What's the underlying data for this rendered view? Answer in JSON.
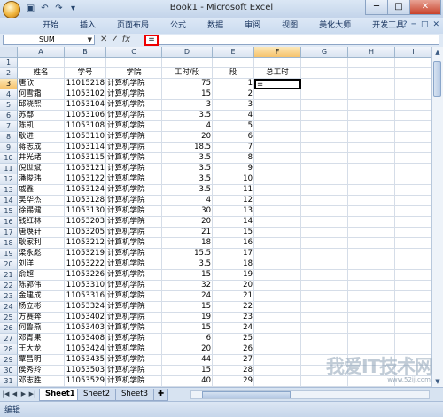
{
  "window": {
    "title": "Book1 - Microsoft Excel"
  },
  "quick_access": [
    "save-icon",
    "undo-icon",
    "redo-icon",
    "dropdown-icon"
  ],
  "window_buttons": {
    "minimize": "─",
    "maximize": "□",
    "close": "✕"
  },
  "ribbon": {
    "tabs": [
      "开始",
      "插入",
      "页面布局",
      "公式",
      "数据",
      "审阅",
      "视图",
      "美化大师",
      "开发工具"
    ],
    "right_icons": [
      "?",
      "─",
      "□",
      "✕"
    ]
  },
  "formula_bar": {
    "name_box": "SUM",
    "cancel": "✕",
    "enter": "✓",
    "fx": "fx",
    "value": "="
  },
  "grid": {
    "columns": [
      "A",
      "B",
      "C",
      "D",
      "E",
      "F",
      "G",
      "H",
      "I"
    ],
    "selected_column": "F",
    "selected_row": "3",
    "active_cell_value": "=",
    "header_row": {
      "row": "2",
      "a": "姓名",
      "b": "学号",
      "c": "学院",
      "d": "工时/段",
      "e": "段",
      "f": "总工时"
    },
    "rows": [
      {
        "row": "1",
        "a": "",
        "b": "",
        "c": "",
        "d": "",
        "e": ""
      },
      {
        "row": "3",
        "a": "唐欣",
        "b": "11015218",
        "c": "计算机学院",
        "d": "75",
        "e": "1"
      },
      {
        "row": "4",
        "a": "何雪霜",
        "b": "11053102",
        "c": "计算机学院",
        "d": "15",
        "e": "2"
      },
      {
        "row": "5",
        "a": "邱晓熙",
        "b": "11053104",
        "c": "计算机学院",
        "d": "3",
        "e": "3"
      },
      {
        "row": "6",
        "a": "苏鄢",
        "b": "11053106",
        "c": "计算机学院",
        "d": "3.5",
        "e": "4"
      },
      {
        "row": "7",
        "a": "陈凯",
        "b": "11053108",
        "c": "计算机学院",
        "d": "4",
        "e": "5"
      },
      {
        "row": "8",
        "a": "耿进",
        "b": "11053110",
        "c": "计算机学院",
        "d": "20",
        "e": "6"
      },
      {
        "row": "9",
        "a": "蒋志成",
        "b": "11053114",
        "c": "计算机学院",
        "d": "18.5",
        "e": "7"
      },
      {
        "row": "10",
        "a": "井光绪",
        "b": "11053115",
        "c": "计算机学院",
        "d": "3.5",
        "e": "8"
      },
      {
        "row": "11",
        "a": "  倪世斌",
        "b": "11053121",
        "c": "计算机学院",
        "d": "3.5",
        "e": "9"
      },
      {
        "row": "12",
        "a": "潘俊玮",
        "b": "11053122",
        "c": "计算机学院",
        "d": "3.5",
        "e": "10"
      },
      {
        "row": "13",
        "a": "戚鑫",
        "b": "11053124",
        "c": "计算机学院",
        "d": "3.5",
        "e": "11"
      },
      {
        "row": "14",
        "a": "吴华杰",
        "b": "11053128",
        "c": "计算机学院",
        "d": "4",
        "e": "12"
      },
      {
        "row": "15",
        "a": "徐锡健",
        "b": "11053130",
        "c": "计算机学院",
        "d": "30",
        "e": "13"
      },
      {
        "row": "16",
        "a": "钱红林",
        "b": "11053203",
        "c": "计算机学院",
        "d": "20",
        "e": "14"
      },
      {
        "row": "17",
        "a": "唐焕轩",
        "b": "11053205",
        "c": "计算机学院",
        "d": "21",
        "e": "15"
      },
      {
        "row": "18",
        "a": "耿家利",
        "b": "11053212",
        "c": "计算机学院",
        "d": "18",
        "e": "16"
      },
      {
        "row": "19",
        "a": "梁永彪",
        "b": "11053219",
        "c": "计算机学院",
        "d": "15.5",
        "e": "17"
      },
      {
        "row": "20",
        "a": "刘洋",
        "b": "11053222",
        "c": "计算机学院",
        "d": "3.5",
        "e": "18"
      },
      {
        "row": "21",
        "a": "俞超",
        "b": "11053226",
        "c": "计算机学院",
        "d": "15",
        "e": "19"
      },
      {
        "row": "22",
        "a": "陈郭伟",
        "b": "11053310",
        "c": "计算机学院",
        "d": "32",
        "e": "20"
      },
      {
        "row": "23",
        "a": "金建成",
        "b": "11053316",
        "c": "计算机学院",
        "d": "24",
        "e": "21"
      },
      {
        "row": "24",
        "a": "杨立彬",
        "b": "11053324",
        "c": "计算机学院",
        "d": "15",
        "e": "22"
      },
      {
        "row": "25",
        "a": "方赛奔",
        "b": "11053402",
        "c": "计算机学院",
        "d": "19",
        "e": "23"
      },
      {
        "row": "26",
        "a": "何鲁燕",
        "b": "11053403",
        "c": "计算机学院",
        "d": "15",
        "e": "24"
      },
      {
        "row": "27",
        "a": "邓青果",
        "b": "11053408",
        "c": "计算机学院",
        "d": "6",
        "e": "25"
      },
      {
        "row": "28",
        "a": "王大龙",
        "b": "11053424",
        "c": "计算机学院",
        "d": "20",
        "e": "26"
      },
      {
        "row": "29",
        "a": "覃昌明",
        "b": "11053435",
        "c": "计算机学院",
        "d": "44",
        "e": "27"
      },
      {
        "row": "30",
        "a": "侯秀羚",
        "b": "11053503",
        "c": "计算机学院",
        "d": "15",
        "e": "28"
      },
      {
        "row": "31",
        "a": "邓志胜",
        "b": "11053529",
        "c": "计算机学院",
        "d": "40",
        "e": "29"
      },
      {
        "row": "32",
        "a": "吴林俊",
        "b": "11053539",
        "c": "计算机学院",
        "d": "30",
        "e": "30"
      }
    ]
  },
  "sheets": [
    "Sheet1",
    "Sheet2",
    "Sheet3"
  ],
  "active_sheet": "Sheet1",
  "status": {
    "mode": "编辑"
  },
  "watermark": {
    "text": "我爱IT技术网",
    "url": "www.52ij.com"
  },
  "colors": {
    "title_bg": "#c3d4ea",
    "selected_header": "#f6c26b",
    "highlight": "#e00000"
  }
}
